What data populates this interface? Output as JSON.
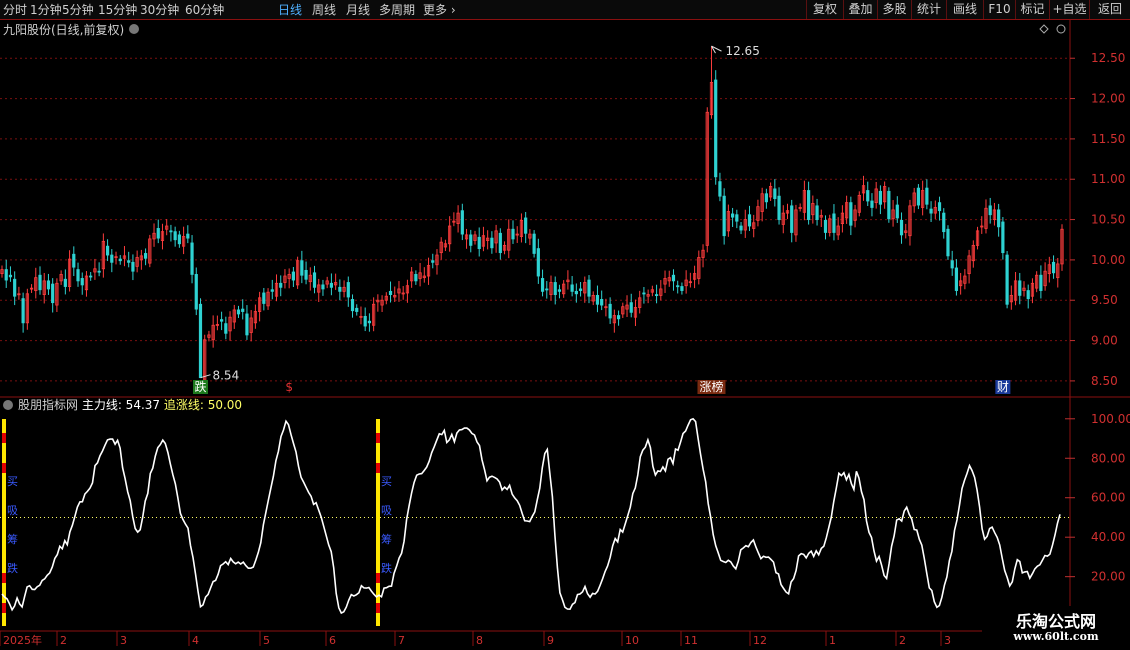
{
  "toolbar": {
    "periods": [
      "分时",
      "1分钟",
      "5分钟",
      "15分钟",
      "30分钟",
      "60分钟",
      "日线",
      "周线",
      "月线",
      "多周期",
      "更多"
    ],
    "active_period": "日线",
    "more_glyph": "›",
    "right_buttons": [
      "复权",
      "叠加",
      "多股",
      "统计",
      "画线",
      "F10",
      "标记",
      "+自选",
      "返回"
    ]
  },
  "colors": {
    "up": "#ff3d3d",
    "down": "#2fd2d2",
    "grid": "#7a1010",
    "main_line": "#ffffff",
    "ref_line": "#ffff66",
    "yellow_bar": "#ffe600",
    "red_bar": "#e00000"
  },
  "chart_data": [
    {
      "type": "candlestick",
      "title": "九阳股份(日线,前复权)",
      "yticks": [
        8.5,
        9.0,
        9.5,
        10.0,
        10.5,
        11.0,
        11.5,
        12.0,
        12.5
      ],
      "ylim": [
        8.35,
        12.85
      ],
      "high_label": "12.65",
      "low_label": "8.54",
      "event_markers": [
        {
          "label": "跌",
          "bar": 47,
          "kind": "down"
        },
        {
          "label": "$",
          "bar": 68,
          "kind": "dollar"
        },
        {
          "label": "涨榜",
          "bar": 168,
          "kind": "up"
        },
        {
          "label": "财",
          "bar": 237,
          "kind": "fin"
        }
      ],
      "closes": [
        9.88,
        9.75,
        9.79,
        9.55,
        9.58,
        9.22,
        9.58,
        9.65,
        9.78,
        9.63,
        9.74,
        9.64,
        9.47,
        9.71,
        9.82,
        9.67,
        10.01,
        9.91,
        9.74,
        9.69,
        9.8,
        9.79,
        9.89,
        9.86,
        10.23,
        10.06,
        9.97,
        10.04,
        9.99,
        10.05,
        9.97,
        9.86,
        10.03,
        10.05,
        10.02,
        10.26,
        10.33,
        10.27,
        10.35,
        10.42,
        10.35,
        10.25,
        10.2,
        10.29,
        10.27,
        9.82,
        9.39,
        8.54,
        9.01,
        9.07,
        9.19,
        9.2,
        9.24,
        9.09,
        9.29,
        9.38,
        9.33,
        9.36,
        9.07,
        9.28,
        9.36,
        9.53,
        9.46,
        9.6,
        9.61,
        9.71,
        9.66,
        9.8,
        9.82,
        9.75,
        9.99,
        9.81,
        9.76,
        9.81,
        9.66,
        9.69,
        9.64,
        9.74,
        9.66,
        9.72,
        9.61,
        9.66,
        9.54,
        9.37,
        9.36,
        9.3,
        9.18,
        9.22,
        9.45,
        9.5,
        9.5,
        9.55,
        9.57,
        9.56,
        9.64,
        9.59,
        9.68,
        9.85,
        9.74,
        9.84,
        9.8,
        9.93,
        9.97,
        10.06,
        10.22,
        10.2,
        10.42,
        10.48,
        10.58,
        10.32,
        10.31,
        10.18,
        10.31,
        10.14,
        10.3,
        10.27,
        10.15,
        10.36,
        10.09,
        10.18,
        10.38,
        10.26,
        10.32,
        10.49,
        10.33,
        10.32,
        10.08,
        9.8,
        9.61,
        9.63,
        9.72,
        9.57,
        9.61,
        9.7,
        9.75,
        9.61,
        9.58,
        9.62,
        9.72,
        9.55,
        9.56,
        9.45,
        9.44,
        9.42,
        9.28,
        9.31,
        9.27,
        9.42,
        9.44,
        9.35,
        9.41,
        9.53,
        9.58,
        9.57,
        9.63,
        9.56,
        9.64,
        9.77,
        9.78,
        9.74,
        9.67,
        9.62,
        9.75,
        9.73,
        9.83,
        10.03,
        10.12,
        11.83,
        12.2,
        11.03,
        10.79,
        10.3,
        10.6,
        10.53,
        10.48,
        10.37,
        10.5,
        10.42,
        10.46,
        10.66,
        10.82,
        10.72,
        10.91,
        10.76,
        10.5,
        10.58,
        10.61,
        10.34,
        10.62,
        10.65,
        10.86,
        10.5,
        10.7,
        10.5,
        10.55,
        10.34,
        10.51,
        10.34,
        10.42,
        10.58,
        10.71,
        10.43,
        10.62,
        10.8,
        10.92,
        10.73,
        10.65,
        10.88,
        10.69,
        10.91,
        10.51,
        10.62,
        10.52,
        10.31,
        10.36,
        10.67,
        10.83,
        10.68,
        10.86,
        10.69,
        10.58,
        10.65,
        10.61,
        10.35,
        10.05,
        9.9,
        9.62,
        9.74,
        9.8,
        10.05,
        10.18,
        10.36,
        10.42,
        10.64,
        10.56,
        10.62,
        10.41,
        10.09,
        9.45,
        9.56,
        9.74,
        9.56,
        9.65,
        9.52,
        9.71,
        9.81,
        9.62,
        9.86,
        9.94,
        9.84,
        9.95,
        10.38
      ]
    },
    {
      "type": "line",
      "title": "股朋指标网",
      "series": [
        {
          "name": "主力线",
          "value_label": "54.37",
          "values": [
            11.2,
            9.7,
            8.8,
            6.3,
            3.2,
            5.2,
            9.2,
            6.2,
            4.7,
            9.9,
            14.8,
            15.4,
            13.6,
            13.5,
            14.9,
            15.6,
            18.1,
            18.9,
            20.7,
            21.9,
            24.9,
            29.2,
            31.2,
            35.4,
            34.1,
            38.2,
            36.2,
            42.7,
            46.1,
            50.6,
            55.3,
            57.9,
            58.0,
            61.9,
            63.2,
            64.9,
            67.5,
            76.3,
            77.7,
            81.3,
            83.7,
            86.6,
            89.3,
            89.7,
            89.7,
            87.1,
            89.1,
            85.2,
            75.2,
            69.7,
            63.0,
            58.5,
            50.5,
            44.4,
            42.6,
            43.8,
            50.2,
            58.3,
            62.2,
            72.3,
            75.0,
            81.1,
            85.4,
            86.9,
            89.2,
            87.5,
            82.9,
            77.0,
            71.6,
            66.9,
            59.8,
            52.1,
            49.0,
            46.6,
            44.6,
            35.8,
            29.7,
            21.4,
            12.6,
            4.8,
            5.7,
            9.7,
            11.0,
            14.3,
            17.5,
            18.1,
            21.2,
            25.6,
            26.4,
            27.6,
            26.1,
            29.2,
            27.5,
            26.5,
            27.4,
            26.4,
            27.4,
            25.6,
            24.3,
            24.3,
            24.9,
            28.4,
            32.3,
            37.2,
            46.4,
            52.6,
            58.9,
            65.0,
            70.9,
            78.7,
            83.5,
            91.0,
            94.3,
            98.8,
            97.0,
            92.0,
            87.5,
            83.2,
            76.0,
            70.3,
            67.9,
            65.3,
            62.7,
            60.7,
            56.6,
            57.5,
            53.9,
            50.2,
            45.5,
            40.8,
            36.1,
            32.7,
            24.5,
            11.5,
            4.2,
            1.6,
            2.2,
            4.6,
            8.2,
            10.9,
            10.2,
            10.8,
            11.8,
            15.4,
            14.3,
            14.2,
            14.5,
            12.7,
            11.1,
            9.8,
            10.6,
            9.8,
            14.2,
            14.4,
            15.1,
            15.2,
            21.6,
            25.3,
            29.4,
            31.9,
            38.0,
            48.9,
            55.9,
            62.4,
            67.7,
            71.4,
            72.0,
            72.2,
            73.8,
            75.5,
            78.5,
            82.8,
            85.8,
            89.2,
            92.4,
            92.0,
            94.1,
            88.0,
            89.3,
            92.1,
            88.4,
            92.8,
            94.3,
            94.5,
            95.3,
            95.3,
            94.3,
            92.6,
            91.8,
            88.3,
            86.4,
            79.2,
            74.3,
            68.6,
            70.4,
            70.9,
            70.3,
            69.5,
            67.9,
            63.9,
            65.4,
            64.2,
            66.3,
            61.8,
            59.9,
            58.5,
            56.1,
            52.0,
            48.3,
            48.2,
            47.9,
            50.6,
            52.8,
            59.0,
            64.9,
            75.2,
            82.4,
            84.5,
            72.6,
            60.5,
            41.0,
            24.6,
            11.8,
            8.4,
            4.5,
            3.6,
            3.5,
            6.0,
            6.9,
            10.9,
            11.2,
            12.3,
            15.0,
            11.4,
            9.6,
            11.5,
            11.2,
            12.6,
            15.6,
            18.9,
            22.6,
            25.4,
            29.8,
            35.7,
            39.3,
            37.6,
            43.9,
            42.6,
            46.7,
            51.0,
            55.2,
            62.1,
            65.0,
            71.5,
            80.8,
            84.1,
            85.6,
            89.3,
            85.4,
            75.9,
            71.5,
            73.6,
            73.3,
            75.6,
            73.6,
            79.5,
            80.3,
            77.3,
            84.7,
            84.1,
            88.1,
            92.5,
            93.8,
            96.8,
            99.5,
            100.0,
            98.6,
            90.0,
            81.9,
            74.5,
            68.0,
            57.0,
            50.1,
            41.3,
            35.7,
            32.1,
            28.3,
            27.7,
            27.2,
            28.3,
            27.5,
            25.4,
            24.0,
            27.8,
            33.6,
            34.6,
            35.7,
            35.2,
            37.3,
            38.6,
            35.1,
            32.0,
            29.1,
            30.3,
            29.8,
            29.9,
            28.7,
            27.4,
            22.0,
            21.4,
            16.0,
            14.0,
            12.2,
            11.3,
            17.3,
            19.0,
            23.1,
            30.5,
            31.7,
            31.3,
            29.5,
            31.8,
            32.9,
            30.2,
            33.1,
            31.1,
            34.3,
            35.4,
            39.7,
            44.9,
            50.2,
            58.2,
            64.9,
            72.4,
            71.2,
            72.7,
            69.1,
            71.8,
            67.1,
            64.2,
            73.4,
            69.9,
            63.0,
            59.0,
            48.2,
            42.5,
            39.9,
            33.0,
            27.9,
            30.2,
            25.8,
            20.6,
            19.1,
            26.6,
            35.4,
            40.6,
            48.7,
            49.3,
            48.2,
            53.2,
            55.2,
            51.6,
            49.2,
            43.9,
            43.6,
            39.0,
            36.0,
            29.2,
            21.6,
            14.3,
            13.0,
            7.3,
            4.5,
            5.4,
            9.6,
            15.6,
            19.9,
            28.2,
            32.8,
            43.4,
            48.7,
            56.3,
            64.7,
            68.8,
            72.3,
            76.3,
            73.8,
            70.3,
            63.8,
            55.3,
            44.3,
            39.0,
            40.4,
            44.4,
            45.1,
            42.3,
            39.9,
            36.1,
            29.4,
            23.1,
            19.6,
            15.3,
            17.4,
            23.9,
            28.6,
            27.7,
            21.9,
            22.4,
            22.6,
            19.2,
            21.5,
            24.0,
            25.3,
            26.0,
            28.3,
            30.7,
            30.4,
            31.4,
            36.0,
            41.1,
            47.1,
            51.6
          ]
        },
        {
          "name": "追涨线",
          "value_label": "50.00",
          "values": [
            50
          ]
        }
      ],
      "yticks": [
        20.0,
        40.0,
        60.0,
        80.0,
        100.0
      ],
      "ylim": [
        -5,
        108
      ],
      "left_markers": [
        "买",
        "吸",
        "筹",
        "跌"
      ],
      "x_labels": [
        "2025年",
        "2",
        "3",
        "4",
        "5",
        "6",
        "7",
        "8",
        "9",
        "10",
        "11",
        "12",
        "1",
        "2",
        "3"
      ]
    }
  ],
  "watermark": {
    "line1": "乐淘公式网",
    "line2": "www.60lt.com"
  }
}
